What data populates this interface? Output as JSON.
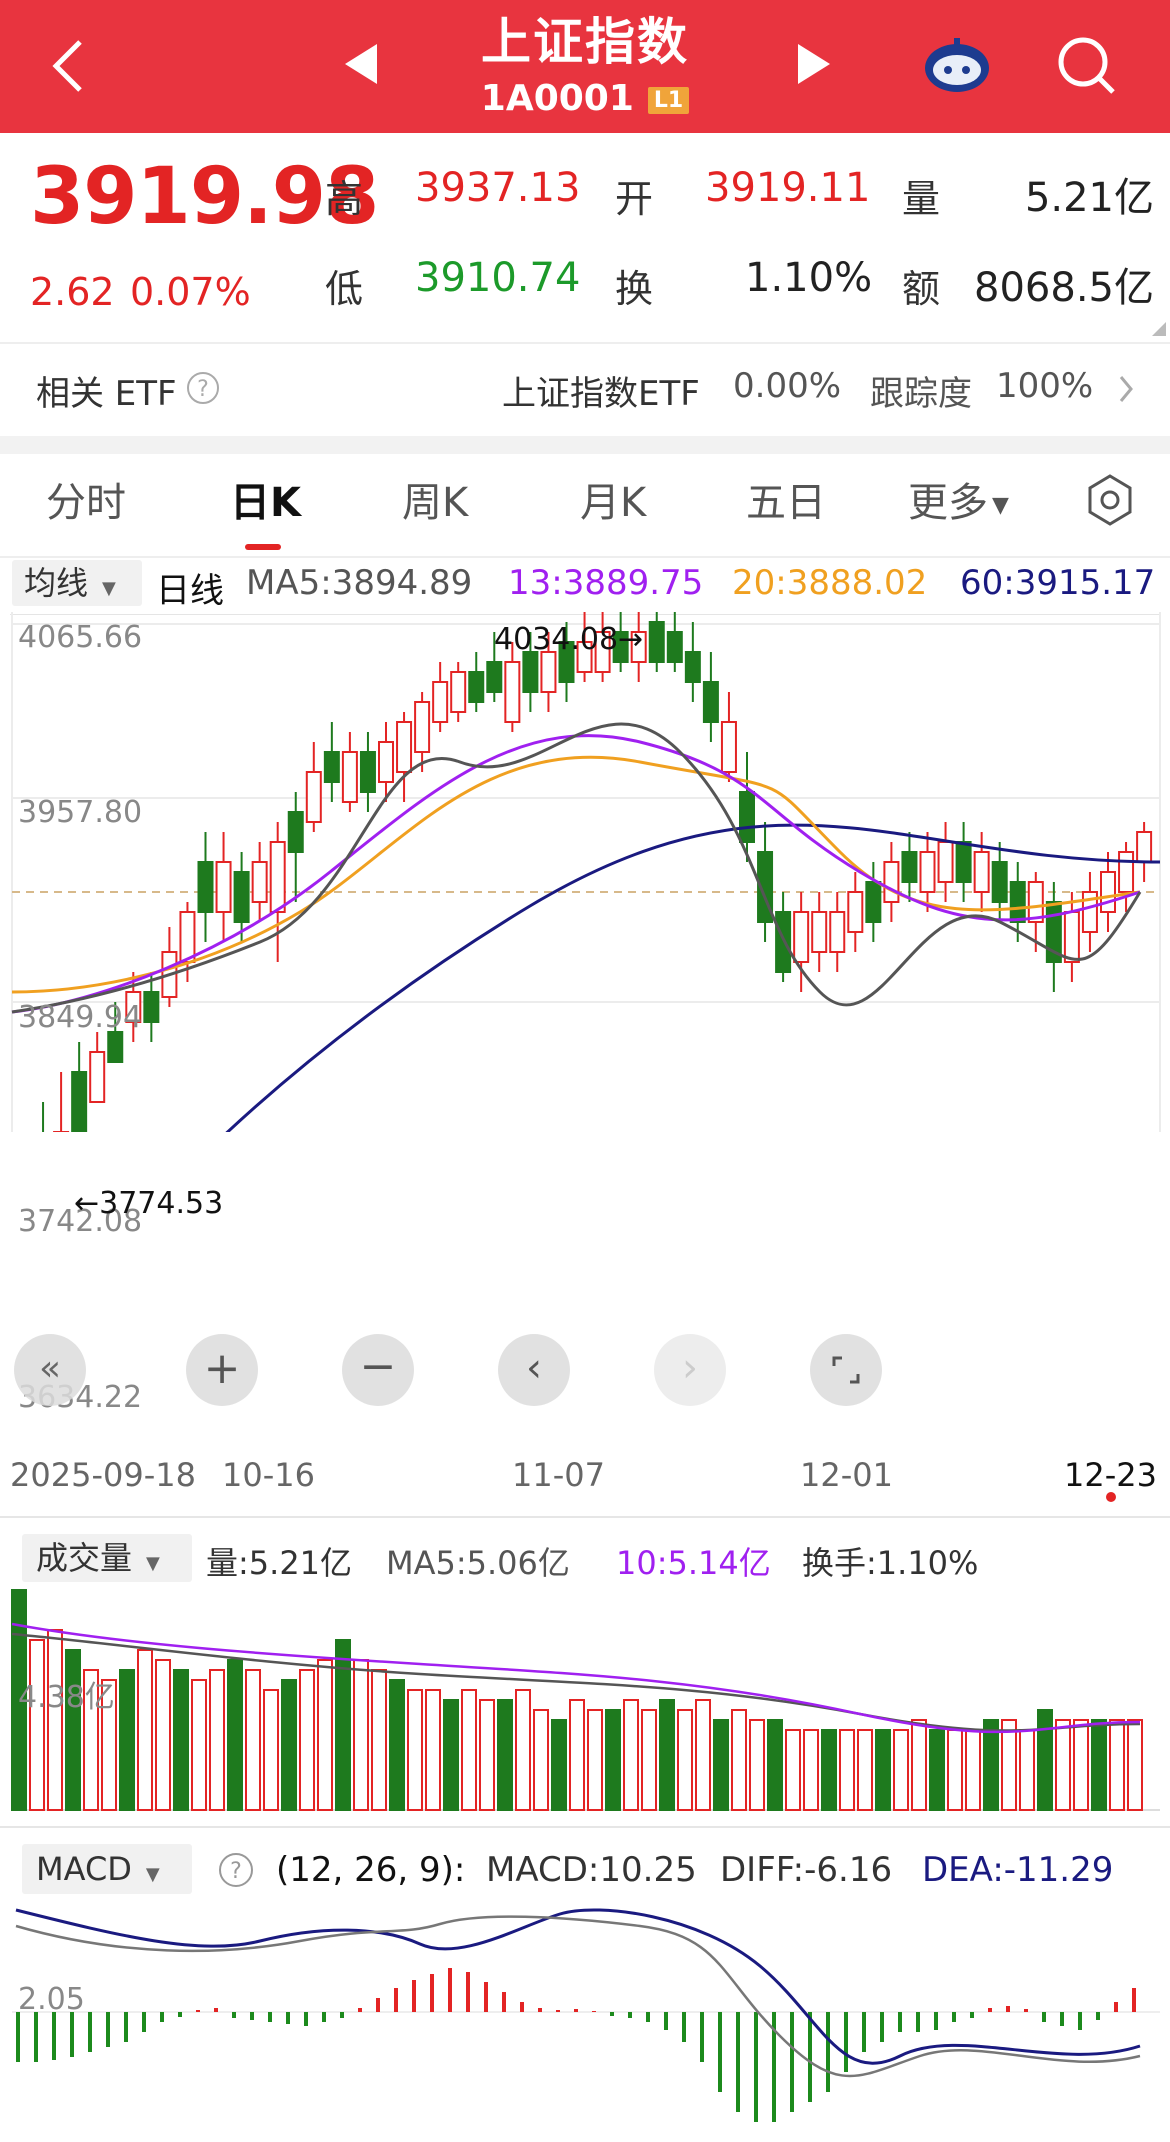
{
  "header": {
    "title": "上证指数",
    "code": "1A0001",
    "level_badge": "L1",
    "bg_color": "#e8343f"
  },
  "quote": {
    "price": "3919.98",
    "change": "2.62",
    "change_pct": "0.07%",
    "high_label": "高",
    "high": "3937.13",
    "low_label": "低",
    "low": "3910.74",
    "open_label": "开",
    "open": "3919.11",
    "turnover_label": "换",
    "turnover": "1.10%",
    "volume_label": "量",
    "volume": "5.21亿",
    "amount_label": "额",
    "amount": "8068.5亿"
  },
  "etf": {
    "label": "相关 ETF",
    "name": "上证指数ETF",
    "change": "0.00%",
    "tracking_label": "跟踪度",
    "tracking": "100%"
  },
  "tabs": [
    "分时",
    "日K",
    "周K",
    "月K",
    "五日",
    "更多"
  ],
  "active_tab": "日K",
  "ma_bar": {
    "selector": "均线",
    "period": "日线",
    "ma5": "MA5:3894.89",
    "ma13": "13:3889.75",
    "ma20": "20:3888.02",
    "ma60": "60:3915.17"
  },
  "kline": {
    "y_labels": [
      "4065.66",
      "3957.80",
      "3849.94",
      "3742.08",
      "3634.22"
    ],
    "high_marker": "4034.08→",
    "low_marker": "←3774.53",
    "dates": [
      "2025-09-18",
      "10-16",
      "11-07",
      "12-01",
      "12-23"
    ]
  },
  "volume_bar": {
    "selector": "成交量",
    "vol": "量:5.21亿",
    "ma5": "MA5:5.06亿",
    "ma10": "10:5.14亿",
    "turnover": "换手:1.10%",
    "y_label": "4.38亿"
  },
  "macd_bar": {
    "selector": "MACD",
    "params": "(12, 26, 9):",
    "macd": "MACD:10.25",
    "diff": "DIFF:-6.16",
    "dea": "DEA:-11.29",
    "y_label": "2.05"
  },
  "colors": {
    "up": "#e32424",
    "down": "#1e7a1e",
    "ma5": "#555555",
    "ma13": "#a020f0",
    "ma20": "#f0a020",
    "ma60": "#1a1a80"
  }
}
